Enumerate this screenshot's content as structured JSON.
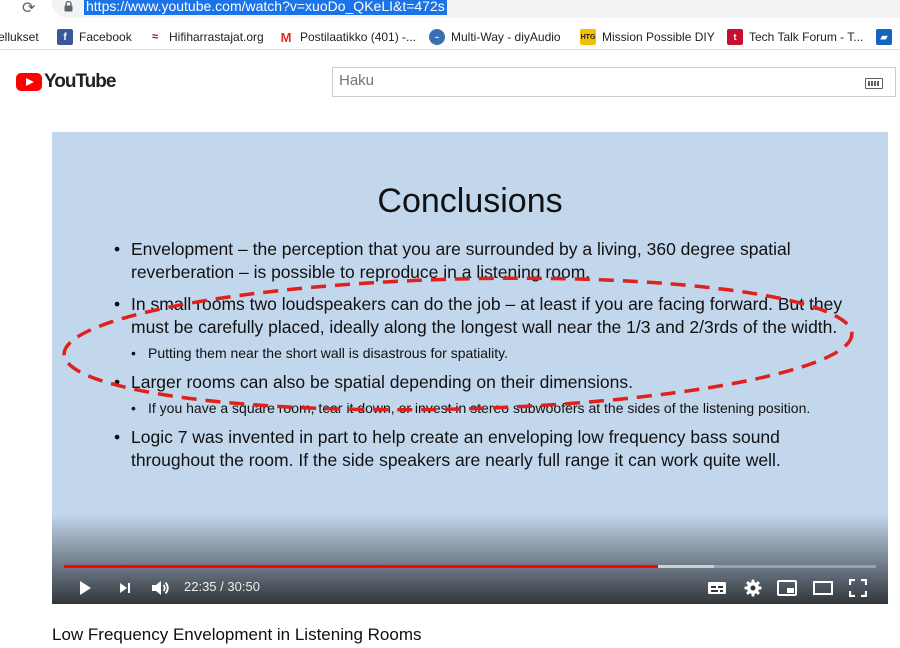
{
  "browser": {
    "url": "https://www.youtube.com/watch?v=xuoDo_QKeLI&t=472s",
    "bookmarks": [
      {
        "label": "ellukset",
        "icon": "partial-icon"
      },
      {
        "label": "Facebook",
        "icon": "facebook-icon"
      },
      {
        "label": "Hifiharrastajat.org",
        "icon": "hifi-icon"
      },
      {
        "label": "Postilaatikko (401) -...",
        "icon": "gmail-icon"
      },
      {
        "label": "Multi-Way - diyAudio",
        "icon": "diyaudio-icon"
      },
      {
        "label": "Mission Possible DIY",
        "icon": "htg-icon"
      },
      {
        "label": "Tech Talk Forum - T...",
        "icon": "techtalk-icon"
      }
    ]
  },
  "youtube": {
    "logo_text": "YouTube",
    "search_placeholder": "Haku"
  },
  "slide": {
    "title": "Conclusions",
    "b1": "Envelopment – the perception that you are surrounded by a living, 360 degree spatial reverberation – is possible to reproduce in a listening room.",
    "b2": "In small rooms two loudspeakers can do the job – at least if you are facing forward. But they must be carefully placed, ideally along the longest wall near the 1/3 and 2/3rds of the width.",
    "b2_sub": "Putting them near the short wall is disastrous for spatiality.",
    "b3": "Larger rooms can also be spatial depending on their dimensions.",
    "b3_sub": "If you have a square room, tear it down, or invest in stereo subwoofers at the sides of the listening position.",
    "b4": "Logic 7 was invented in part to help create an enveloping low frequency bass sound throughout the room. If the side speakers are nearly full range it can work quite well."
  },
  "player": {
    "current_time": "22:35",
    "separator": " / ",
    "duration": "30:50",
    "played_fraction": 0.732,
    "loaded_fraction": 0.8,
    "annotation_color": "#e0201b",
    "progress_color": "#ff0000"
  },
  "video": {
    "title": "Low Frequency Envelopment in Listening Rooms"
  }
}
